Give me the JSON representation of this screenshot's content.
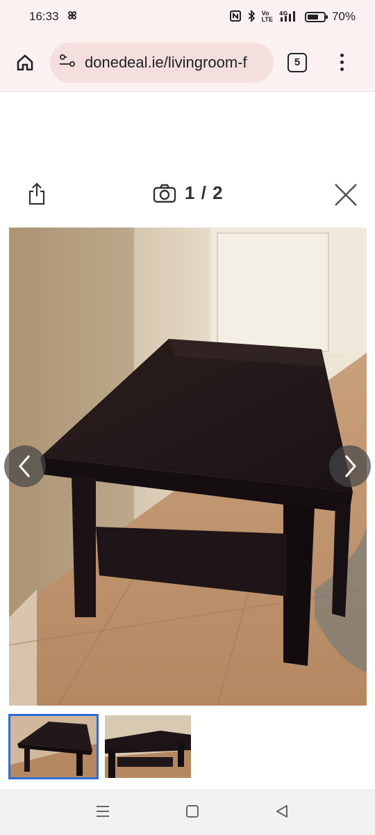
{
  "status_bar": {
    "time": "16:33",
    "network": "4G",
    "battery_percent": "70%",
    "battery_level": 0.7
  },
  "browser": {
    "url": "donedeal.ie/livingroom-f",
    "tab_count": "5"
  },
  "viewer": {
    "counter": "1 / 2",
    "current_index": 1,
    "total": 2
  },
  "thumbnails": [
    {
      "label": "photo 1",
      "selected": true
    },
    {
      "label": "photo 2",
      "selected": false
    }
  ],
  "colors": {
    "status_bg": "#fbf1f1",
    "url_pill": "#f4dede",
    "thumb_selected": "#2f6bd4",
    "arrow_bg": "#464646"
  }
}
